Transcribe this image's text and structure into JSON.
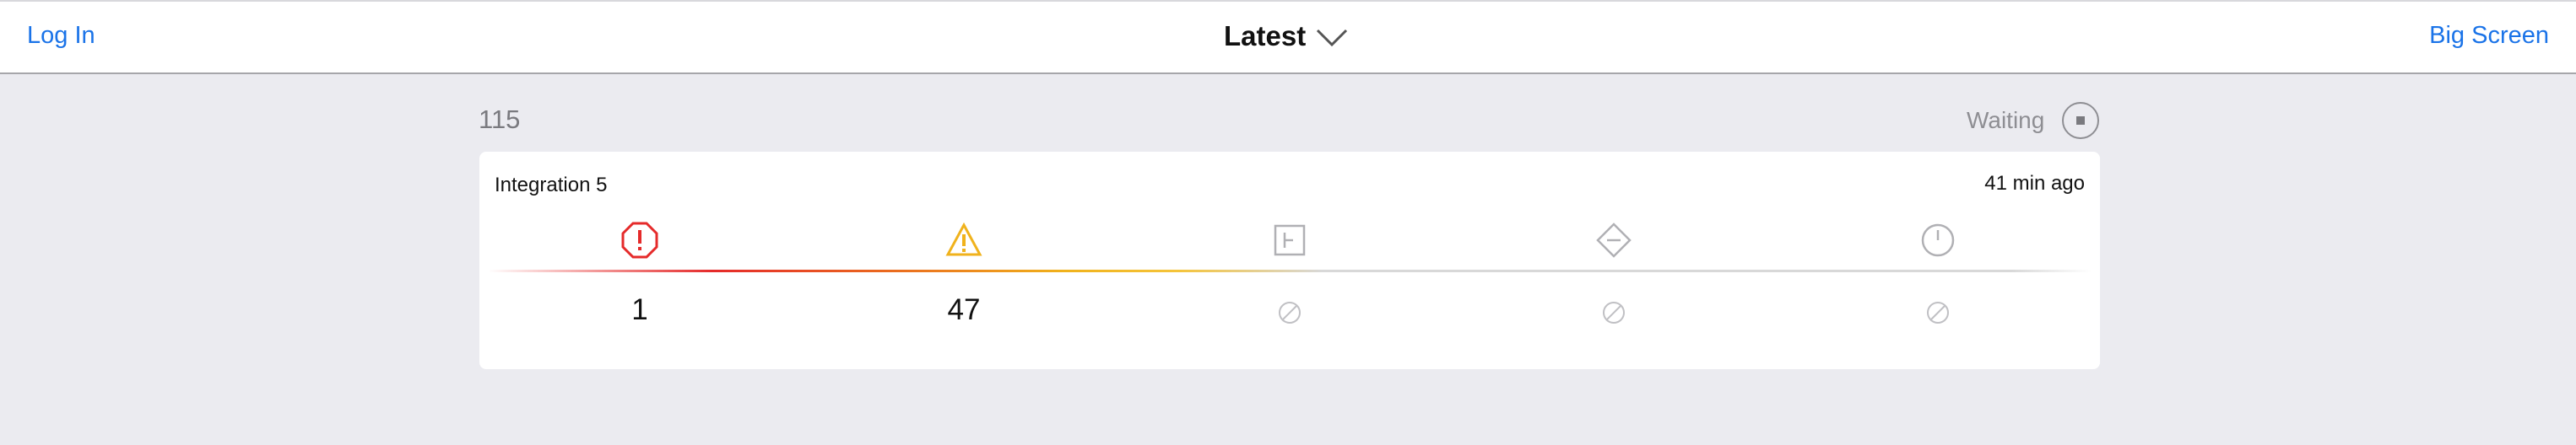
{
  "header": {
    "login_label": "Log In",
    "title": "Latest",
    "big_screen_label": "Big Screen"
  },
  "summary": {
    "count": "115",
    "status": "Waiting"
  },
  "card": {
    "name": "Integration 5",
    "time_ago": "41 min ago",
    "metrics": [
      {
        "icon": "error-octagon-icon",
        "value": "1",
        "color": "#e52a2a"
      },
      {
        "icon": "warning-triangle-icon",
        "value": "47",
        "color": "#f0b21c"
      },
      {
        "icon": "flag-square-icon",
        "value": null,
        "color": "#b0b0b4"
      },
      {
        "icon": "minus-diamond-icon",
        "value": null,
        "color": "#b0b0b4"
      },
      {
        "icon": "clock-icon",
        "value": null,
        "color": "#b0b0b4"
      }
    ]
  },
  "colors": {
    "link": "#1a73e8",
    "background": "#ebebf0"
  }
}
